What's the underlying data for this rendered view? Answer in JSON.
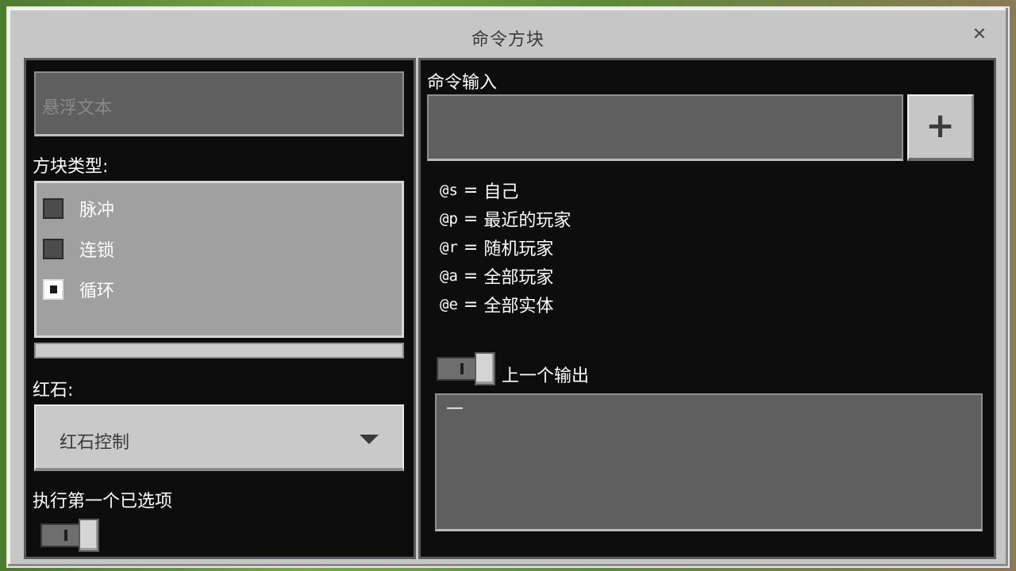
{
  "dialog": {
    "title": "命令方块",
    "close_icon": "close-icon"
  },
  "left": {
    "hover_text_placeholder": "悬浮文本",
    "block_type_label": "方块类型:",
    "block_types": [
      {
        "label": "脉冲",
        "selected": false
      },
      {
        "label": "连锁",
        "selected": false
      },
      {
        "label": "循环",
        "selected": true
      }
    ],
    "redstone_label": "红石:",
    "redstone_value": "红石控制",
    "execute_first_label": "执行第一个已选项"
  },
  "right": {
    "command_input_label": "命令输入",
    "command_value": "",
    "add_icon": "plus-icon",
    "selectors": [
      {
        "code": "@s",
        "eq": " = ",
        "desc": "自己"
      },
      {
        "code": "@p",
        "eq": " = ",
        "desc": "最近的玩家"
      },
      {
        "code": "@r",
        "eq": " = ",
        "desc": "随机玩家"
      },
      {
        "code": "@a",
        "eq": " = ",
        "desc": "全部玩家"
      },
      {
        "code": "@e",
        "eq": " = ",
        "desc": "全部实体"
      }
    ],
    "previous_output_label": "上一个输出",
    "previous_output_value": "—"
  }
}
